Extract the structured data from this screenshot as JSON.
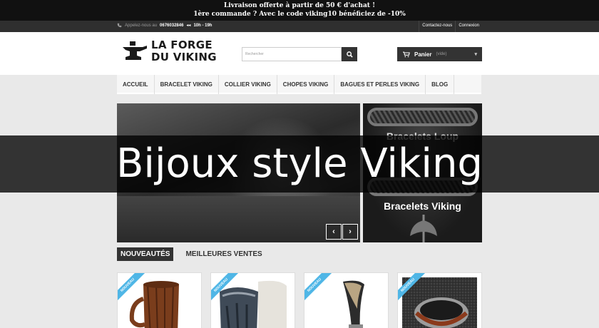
{
  "promo": {
    "line1": "Livraison offerte à partir de 50 € d'achat !",
    "line2": "1ère commande ? Avec le code viking10 bénéficiez de -10%"
  },
  "topbar": {
    "call_label": "Appelez-nous au",
    "phone": "0676032846",
    "hours": "10h - 19h",
    "contact_link": "Contactez-nous",
    "login_link": "Connexion"
  },
  "logo": {
    "line1": "LA FORGE",
    "line2": "DU VIKING"
  },
  "search": {
    "placeholder": "Rechercher"
  },
  "cart": {
    "label": "Panier",
    "status": "(vide)"
  },
  "nav": {
    "items": [
      "ACCUEIL",
      "BRACELET VIKING",
      "COLLIER VIKING",
      "CHOPES VIKING",
      "BAGUES ET PERLES VIKING",
      "BLOG"
    ]
  },
  "banner": {
    "top_label": "Bracelets Loup",
    "bottom_label": "Bracelets Viking"
  },
  "overlay": {
    "title": "Bijoux style Viking"
  },
  "tabs": [
    "NOUVEAUTÉS",
    "MEILLEURES VENTES"
  ],
  "products": [
    {
      "badge": "NOUVEAU",
      "image": "wooden-mug"
    },
    {
      "badge": "NOUVEAU",
      "image": "horn-mug"
    },
    {
      "badge": "NOUVEAU",
      "image": "drinking-horn"
    },
    {
      "badge": "NOUVEAU",
      "image": "ring"
    }
  ],
  "colors": {
    "accent": "#4fb6e6",
    "dark": "#333333",
    "promo_bg": "#111111"
  }
}
